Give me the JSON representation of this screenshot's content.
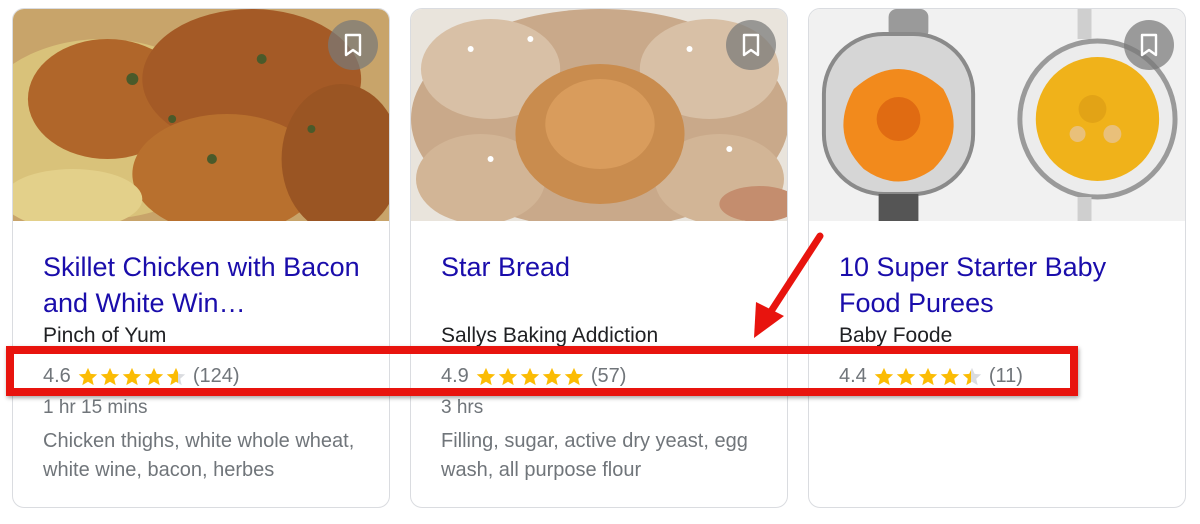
{
  "cards": [
    {
      "title": "Skillet Chicken with Bacon and White Win…",
      "source": "Pinch of Yum",
      "rating": "4.6",
      "stars": [
        1,
        1,
        1,
        1,
        0.6
      ],
      "reviews": "(124)",
      "cook_time": "1 hr 15 mins",
      "ingredients": "Chicken thighs, white whole wheat, white wine, bacon, herbes"
    },
    {
      "title": "Star Bread",
      "source": "Sallys Baking Addiction",
      "rating": "4.9",
      "stars": [
        1,
        1,
        1,
        1,
        1
      ],
      "reviews": "(57)",
      "cook_time": "3 hrs",
      "ingredients": "Filling, sugar, active dry yeast, egg wash, all purpose flour"
    },
    {
      "title": "10 Super Starter Baby Food Purees",
      "source": "Baby Foode",
      "rating": "4.4",
      "stars": [
        1,
        1,
        1,
        1,
        0.45
      ],
      "reviews": "(11)",
      "cook_time": "",
      "ingredients": ""
    }
  ],
  "icons": {
    "bookmark": "bookmark-icon",
    "star": "star-icon"
  },
  "colors": {
    "title_link": "#1a0dab",
    "star_filled": "#fbbc04",
    "star_empty": "#dadce0",
    "annotation": "#e8140e"
  }
}
